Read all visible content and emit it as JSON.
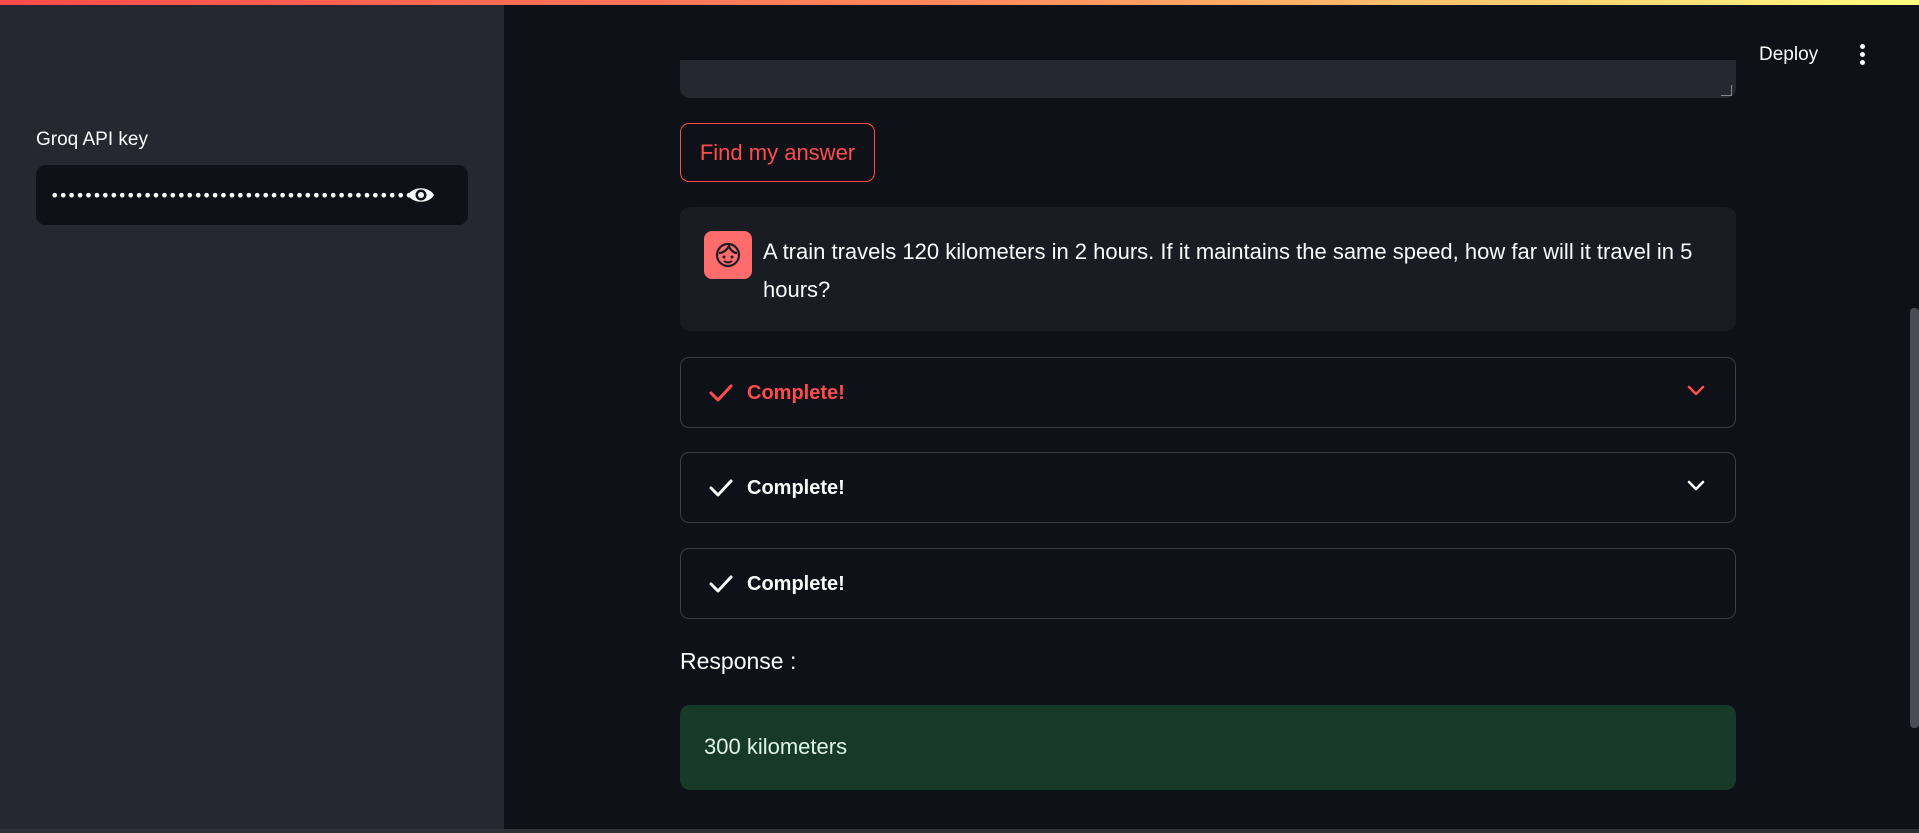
{
  "sidebar": {
    "api_key_label": "Groq API key",
    "api_key_value": "••••••••••••••••••••••••••••••••••••••••••••••••••••••••••",
    "reveal_icon": "eye-icon"
  },
  "header": {
    "deploy_label": "Deploy",
    "menu_icon": "kebab-menu-icon"
  },
  "main": {
    "find_button_label": "Find my answer",
    "question": "A train travels 120 kilometers in 2 hours. If it maintains the same speed, how far will it travel in 5 hours?",
    "avatar_icon": "user-face-icon",
    "expanders": [
      {
        "label": "Complete!",
        "active": true,
        "icon": "check-icon",
        "has_chevron": true
      },
      {
        "label": "Complete!",
        "active": false,
        "icon": "check-icon",
        "has_chevron": true
      },
      {
        "label": "Complete!",
        "active": false,
        "icon": "check-icon",
        "has_chevron": false
      }
    ],
    "response_label": "Response :",
    "response_value": "300 kilometers"
  },
  "colors": {
    "accent": "#ff4b4b",
    "background": "#0e1117",
    "sidebar": "#262730",
    "success_bg": "#173928"
  }
}
